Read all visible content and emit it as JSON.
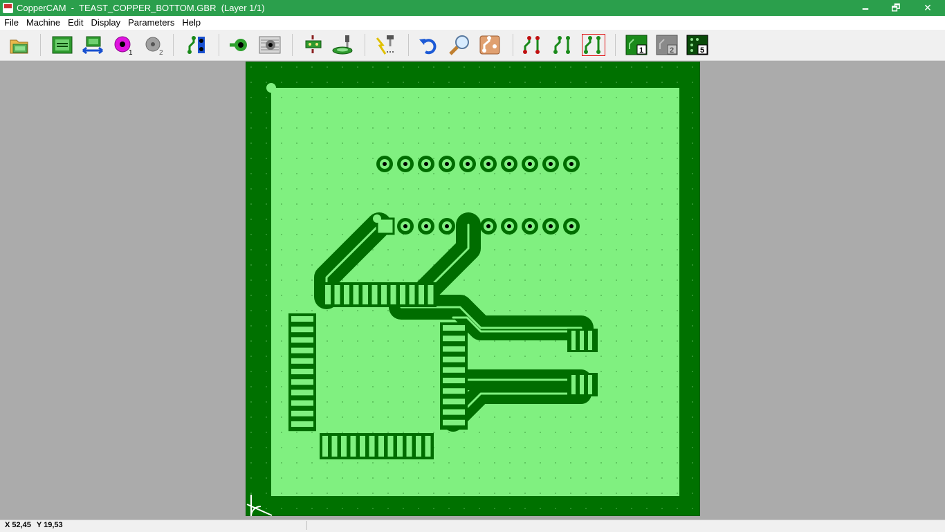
{
  "titlebar": {
    "app_name": "CopperCAM",
    "title": "CopperCAM  -  TEAST_COPPER_BOTTOM.GBR  (Layer 1/1)",
    "minimize": "🗕",
    "restore": "🗗",
    "close": "✕"
  },
  "menu": [
    "File",
    "Machine",
    "Edit",
    "Display",
    "Parameters",
    "Help"
  ],
  "toolbar": {
    "tools": [
      {
        "name": "open-folder-icon"
      },
      {
        "name": "board-view-icon"
      },
      {
        "name": "mirror-board-icon"
      },
      {
        "name": "pad-1-icon",
        "badge": "1"
      },
      {
        "name": "pad-2-icon",
        "badge": "2"
      },
      {
        "name": "track-select-icon"
      },
      {
        "name": "pad-icon"
      },
      {
        "name": "contour-icon"
      },
      {
        "name": "drill-board-icon"
      },
      {
        "name": "mill-tool-icon"
      },
      {
        "name": "laser-engrave-icon"
      },
      {
        "name": "undo-icon"
      },
      {
        "name": "zoom-icon"
      },
      {
        "name": "copper-preview-icon"
      },
      {
        "name": "route-1-icon"
      },
      {
        "name": "route-2-icon"
      },
      {
        "name": "route-3-icon"
      },
      {
        "name": "layer-1-icon",
        "badge": "1"
      },
      {
        "name": "layer-2-icon",
        "badge": "2"
      },
      {
        "name": "layer-5-icon",
        "badge": "5"
      }
    ]
  },
  "colors": {
    "titlebar": "#2b9f4c",
    "board_dark": "#007100",
    "board_light": "#80f080",
    "track": "#006d00",
    "background": "#ababab"
  },
  "status": {
    "x": "X 52,45",
    "y": "Y 19,53"
  }
}
